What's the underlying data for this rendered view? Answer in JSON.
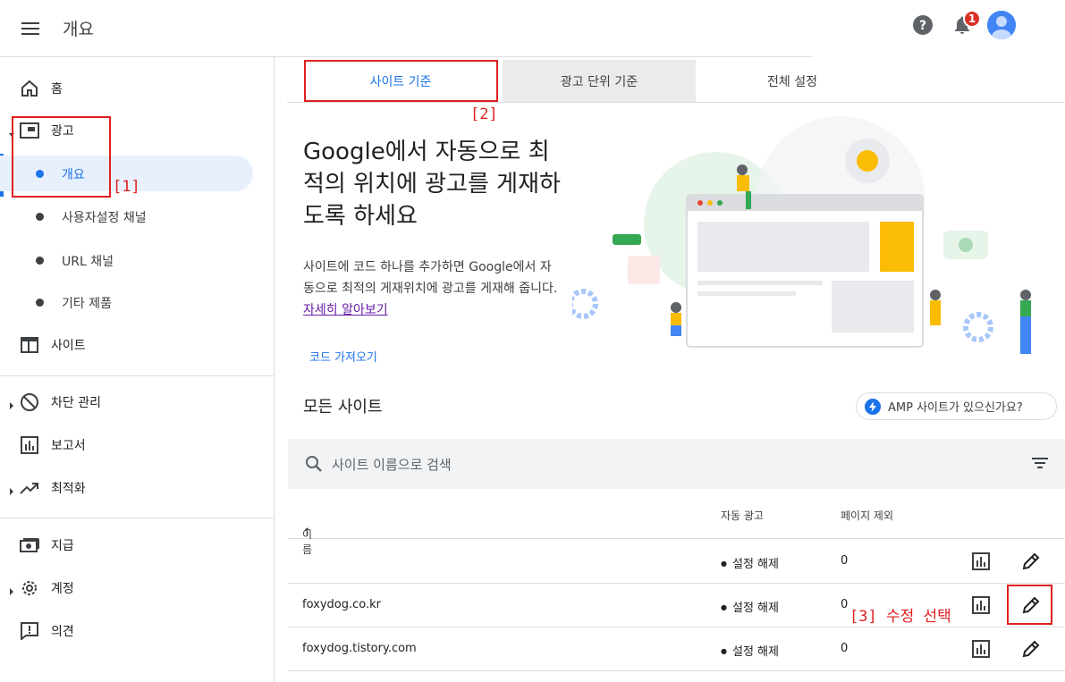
{
  "header": {
    "title": "개요",
    "notification_count": "1"
  },
  "sidebar": {
    "home": "홈",
    "ads": "광고",
    "ads_sub": [
      "개요",
      "사용자설정 채널",
      "URL 채널",
      "기타 제품"
    ],
    "sites": "사이트",
    "blocking": "차단 관리",
    "reports": "보고서",
    "optimization": "최적화",
    "payments": "지급",
    "account": "계정",
    "feedback": "의견"
  },
  "tabs": [
    "사이트 기준",
    "광고 단위 기준",
    "전체 설정"
  ],
  "hero": {
    "title": "Google에서 자동으로 최적의 위치에 광고를 게재하도록 하세요",
    "desc": "사이트에 코드 하나를 추가하면 Google에서 자동으로 최적의 게재위치에 광고를 게재해 줍니다.",
    "learn_more": "자세히 알아보기",
    "get_code": "코드 가져오기"
  },
  "sites_section": {
    "title": "모든 사이트",
    "amp_chip": "AMP 사이트가 있으신가요?",
    "search_placeholder": "사이트 이름으로 검색",
    "columns": [
      "이름",
      "자동 광고",
      "페이지 제외"
    ],
    "rows": [
      {
        "name": "",
        "auto_ads": "설정 해제",
        "excluded": "0"
      },
      {
        "name": "foxydog.co.kr",
        "auto_ads": "설정 해제",
        "excluded": "0"
      },
      {
        "name": "foxydog.tistory.com",
        "auto_ads": "설정 해제",
        "excluded": "0"
      }
    ]
  },
  "annotations": {
    "a1": "[1]",
    "a2": "[2]",
    "a3": "[3] 수정 선택"
  },
  "colors": {
    "accent": "#1a73e8",
    "annotation": "#e02020",
    "active_bg": "#e8f0fe"
  }
}
